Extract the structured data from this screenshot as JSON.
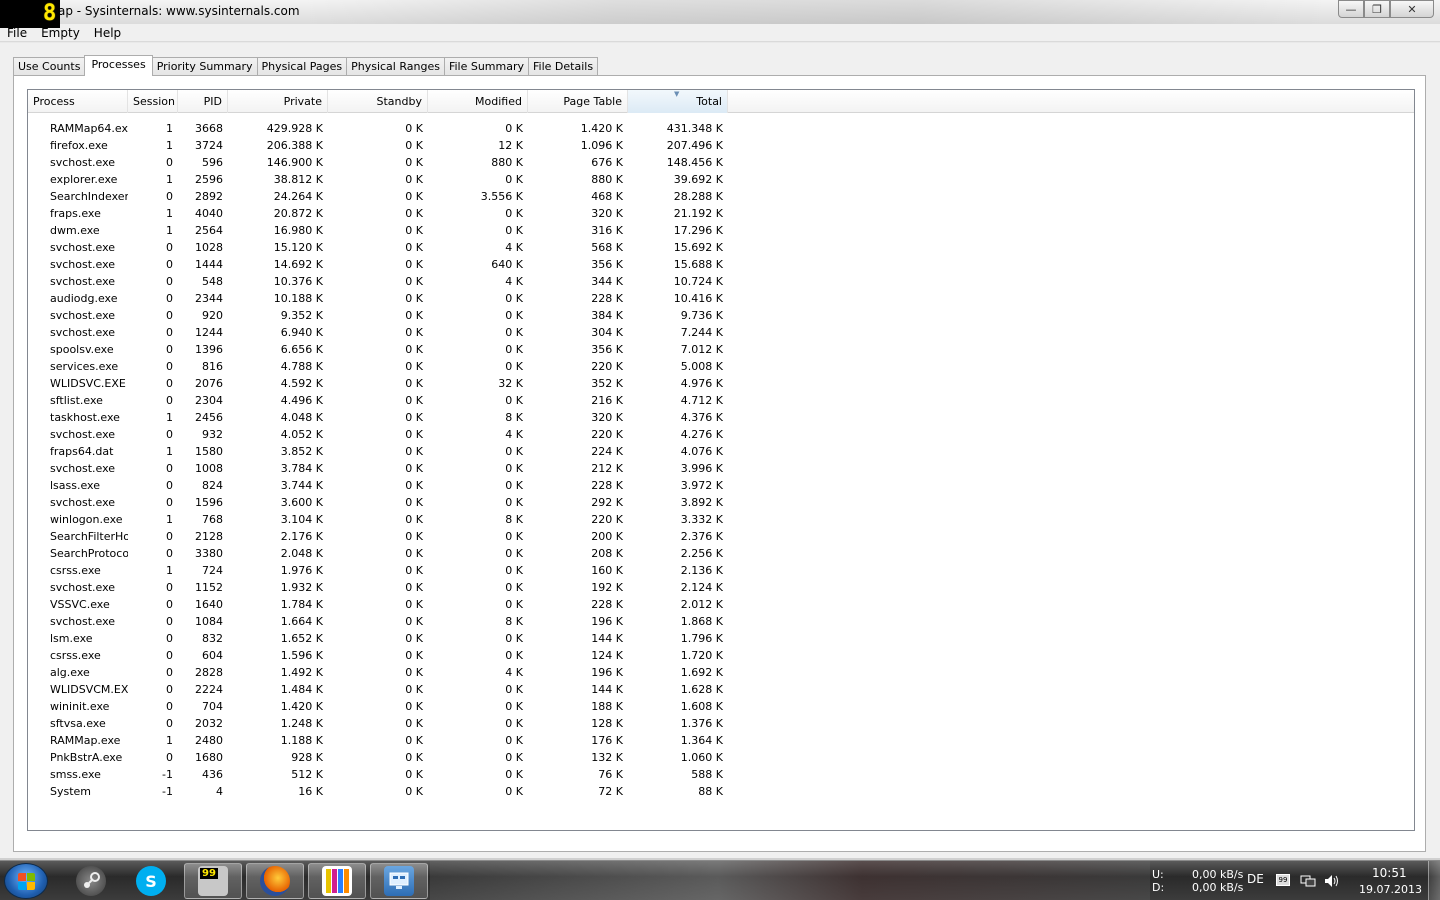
{
  "window": {
    "title": "ap - Sysinternals: www.sysinternals.com",
    "overlay_digit": "8",
    "minimize_glyph": "—",
    "maximize_glyph": "❐",
    "close_glyph": "✕"
  },
  "menu": [
    {
      "label": "File"
    },
    {
      "label": "Empty"
    },
    {
      "label": "Help"
    }
  ],
  "tabs": [
    {
      "label": "Use Counts",
      "active": false
    },
    {
      "label": "Processes",
      "active": true
    },
    {
      "label": "Priority Summary",
      "active": false
    },
    {
      "label": "Physical Pages",
      "active": false
    },
    {
      "label": "Physical Ranges",
      "active": false
    },
    {
      "label": "File Summary",
      "active": false
    },
    {
      "label": "File Details",
      "active": false
    }
  ],
  "columns": [
    "Process",
    "Session",
    "PID",
    "Private",
    "Standby",
    "Modified",
    "Page Table",
    "Total"
  ],
  "sorted_column": "Total",
  "rows": [
    [
      "RAMMap64.exe",
      "1",
      "3668",
      "429.928 K",
      "0 K",
      "0 K",
      "1.420 K",
      "431.348 K"
    ],
    [
      "firefox.exe",
      "1",
      "3724",
      "206.388 K",
      "0 K",
      "12 K",
      "1.096 K",
      "207.496 K"
    ],
    [
      "svchost.exe",
      "0",
      "596",
      "146.900 K",
      "0 K",
      "880 K",
      "676 K",
      "148.456 K"
    ],
    [
      "explorer.exe",
      "1",
      "2596",
      "38.812 K",
      "0 K",
      "0 K",
      "880 K",
      "39.692 K"
    ],
    [
      "SearchIndexer.",
      "0",
      "2892",
      "24.264 K",
      "0 K",
      "3.556 K",
      "468 K",
      "28.288 K"
    ],
    [
      "fraps.exe",
      "1",
      "4040",
      "20.872 K",
      "0 K",
      "0 K",
      "320 K",
      "21.192 K"
    ],
    [
      "dwm.exe",
      "1",
      "2564",
      "16.980 K",
      "0 K",
      "0 K",
      "316 K",
      "17.296 K"
    ],
    [
      "svchost.exe",
      "0",
      "1028",
      "15.120 K",
      "0 K",
      "4 K",
      "568 K",
      "15.692 K"
    ],
    [
      "svchost.exe",
      "0",
      "1444",
      "14.692 K",
      "0 K",
      "640 K",
      "356 K",
      "15.688 K"
    ],
    [
      "svchost.exe",
      "0",
      "548",
      "10.376 K",
      "0 K",
      "4 K",
      "344 K",
      "10.724 K"
    ],
    [
      "audiodg.exe",
      "0",
      "2344",
      "10.188 K",
      "0 K",
      "0 K",
      "228 K",
      "10.416 K"
    ],
    [
      "svchost.exe",
      "0",
      "920",
      "9.352 K",
      "0 K",
      "0 K",
      "384 K",
      "9.736 K"
    ],
    [
      "svchost.exe",
      "0",
      "1244",
      "6.940 K",
      "0 K",
      "0 K",
      "304 K",
      "7.244 K"
    ],
    [
      "spoolsv.exe",
      "0",
      "1396",
      "6.656 K",
      "0 K",
      "0 K",
      "356 K",
      "7.012 K"
    ],
    [
      "services.exe",
      "0",
      "816",
      "4.788 K",
      "0 K",
      "0 K",
      "220 K",
      "5.008 K"
    ],
    [
      "WLIDSVC.EXE",
      "0",
      "2076",
      "4.592 K",
      "0 K",
      "32 K",
      "352 K",
      "4.976 K"
    ],
    [
      "sftlist.exe",
      "0",
      "2304",
      "4.496 K",
      "0 K",
      "0 K",
      "216 K",
      "4.712 K"
    ],
    [
      "taskhost.exe",
      "1",
      "2456",
      "4.048 K",
      "0 K",
      "8 K",
      "320 K",
      "4.376 K"
    ],
    [
      "svchost.exe",
      "0",
      "932",
      "4.052 K",
      "0 K",
      "4 K",
      "220 K",
      "4.276 K"
    ],
    [
      "fraps64.dat",
      "1",
      "1580",
      "3.852 K",
      "0 K",
      "0 K",
      "224 K",
      "4.076 K"
    ],
    [
      "svchost.exe",
      "0",
      "1008",
      "3.784 K",
      "0 K",
      "0 K",
      "212 K",
      "3.996 K"
    ],
    [
      "lsass.exe",
      "0",
      "824",
      "3.744 K",
      "0 K",
      "0 K",
      "228 K",
      "3.972 K"
    ],
    [
      "svchost.exe",
      "0",
      "1596",
      "3.600 K",
      "0 K",
      "0 K",
      "292 K",
      "3.892 K"
    ],
    [
      "winlogon.exe",
      "1",
      "768",
      "3.104 K",
      "0 K",
      "8 K",
      "220 K",
      "3.332 K"
    ],
    [
      "SearchFilterHo",
      "0",
      "2128",
      "2.176 K",
      "0 K",
      "0 K",
      "200 K",
      "2.376 K"
    ],
    [
      "SearchProtocol",
      "0",
      "3380",
      "2.048 K",
      "0 K",
      "0 K",
      "208 K",
      "2.256 K"
    ],
    [
      "csrss.exe",
      "1",
      "724",
      "1.976 K",
      "0 K",
      "0 K",
      "160 K",
      "2.136 K"
    ],
    [
      "svchost.exe",
      "0",
      "1152",
      "1.932 K",
      "0 K",
      "0 K",
      "192 K",
      "2.124 K"
    ],
    [
      "VSSVC.exe",
      "0",
      "1640",
      "1.784 K",
      "0 K",
      "0 K",
      "228 K",
      "2.012 K"
    ],
    [
      "svchost.exe",
      "0",
      "1084",
      "1.664 K",
      "0 K",
      "8 K",
      "196 K",
      "1.868 K"
    ],
    [
      "lsm.exe",
      "0",
      "832",
      "1.652 K",
      "0 K",
      "0 K",
      "144 K",
      "1.796 K"
    ],
    [
      "csrss.exe",
      "0",
      "604",
      "1.596 K",
      "0 K",
      "0 K",
      "124 K",
      "1.720 K"
    ],
    [
      "alg.exe",
      "0",
      "2828",
      "1.492 K",
      "0 K",
      "4 K",
      "196 K",
      "1.692 K"
    ],
    [
      "WLIDSVCM.EXE",
      "0",
      "2224",
      "1.484 K",
      "0 K",
      "0 K",
      "144 K",
      "1.628 K"
    ],
    [
      "wininit.exe",
      "0",
      "704",
      "1.420 K",
      "0 K",
      "0 K",
      "188 K",
      "1.608 K"
    ],
    [
      "sftvsa.exe",
      "0",
      "2032",
      "1.248 K",
      "0 K",
      "0 K",
      "128 K",
      "1.376 K"
    ],
    [
      "RAMMap.exe",
      "1",
      "2480",
      "1.188 K",
      "0 K",
      "0 K",
      "176 K",
      "1.364 K"
    ],
    [
      "PnkBstrA.exe",
      "0",
      "1680",
      "928 K",
      "0 K",
      "0 K",
      "132 K",
      "1.060 K"
    ],
    [
      "smss.exe",
      "-1",
      "436",
      "512 K",
      "0 K",
      "0 K",
      "76 K",
      "588 K"
    ],
    [
      "System",
      "-1",
      "4",
      "16 K",
      "0 K",
      "0 K",
      "72 K",
      "88 K"
    ]
  ],
  "taskbar": {
    "apps": [
      {
        "name": "steam-icon",
        "label": ""
      },
      {
        "name": "skype-icon",
        "label": "S"
      },
      {
        "name": "fraps-icon",
        "label": "99"
      },
      {
        "name": "firefox-icon",
        "label": ""
      },
      {
        "name": "rammap-icon",
        "label": ""
      },
      {
        "name": "network-monitor-icon",
        "label": ""
      }
    ],
    "net_up_label": "U:",
    "net_down_label": "D:",
    "net_up": "0,00 kB/s",
    "net_down": "0,00 kB/s",
    "language": "DE",
    "time": "10:51",
    "date": "19.07.2013"
  }
}
